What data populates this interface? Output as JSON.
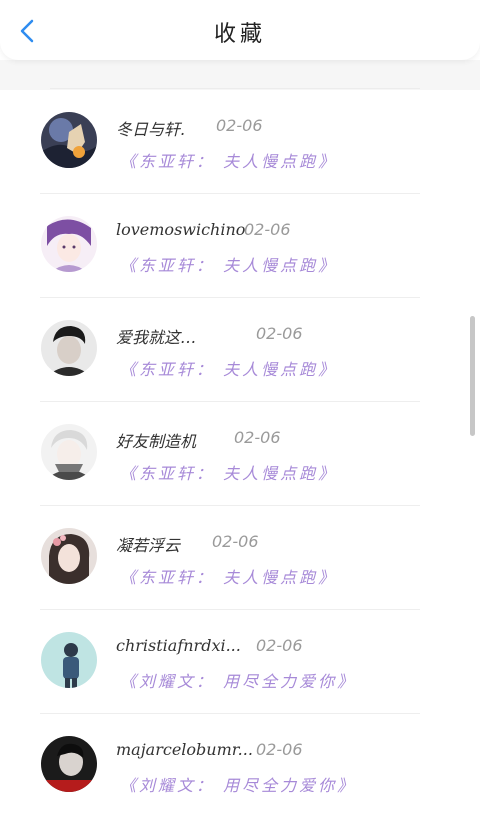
{
  "header": {
    "title": "收藏",
    "back_icon": "chevron-left-icon",
    "accent": "#2e8cf0"
  },
  "colors": {
    "book_title": "#a78ad8",
    "date": "#9a9a9a"
  },
  "favorites": [
    {
      "name": "冬日与轩.",
      "date": "02-06",
      "book": "《东亚轩： 夫人慢点跑》"
    },
    {
      "name": "lovemoswichino",
      "date": "02-06",
      "book": "《东亚轩： 夫人慢点跑》"
    },
    {
      "name": "爱我就这…",
      "date": "02-06",
      "book": "《东亚轩： 夫人慢点跑》"
    },
    {
      "name": "好友制造机",
      "date": "02-06",
      "book": "《东亚轩： 夫人慢点跑》"
    },
    {
      "name": "凝若浮云",
      "date": "02-06",
      "book": "《东亚轩： 夫人慢点跑》"
    },
    {
      "name": "christiafnrdxi...",
      "date": "02-06",
      "book": "《刘耀文： 用尽全力爱你》"
    },
    {
      "name": "majarcelobumr...",
      "date": "02-06",
      "book": "《刘耀文： 用尽全力爱你》"
    }
  ]
}
